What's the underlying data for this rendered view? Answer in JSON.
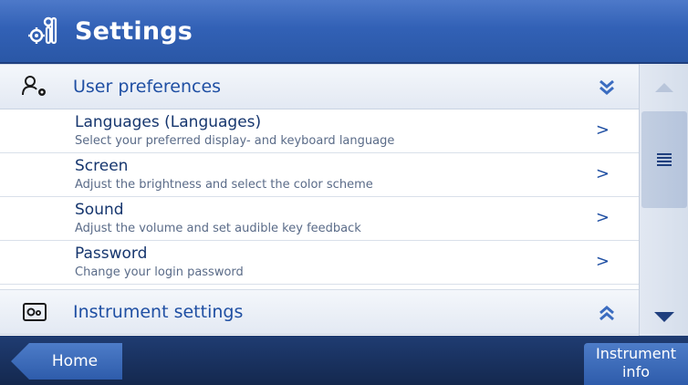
{
  "header": {
    "title": "Settings",
    "icon": "settings-tools-icon"
  },
  "sections": [
    {
      "label": "User preferences",
      "icon": "user-settings-icon",
      "chevron": "double-chevron-down-icon"
    },
    {
      "label": "Instrument settings",
      "icon": "instrument-settings-icon",
      "chevron": "double-chevron-up-icon"
    }
  ],
  "items": [
    {
      "title": "Languages (Languages)",
      "desc": "Select your preferred display- and keyboard language",
      "arrow": ">"
    },
    {
      "title": "Screen",
      "desc": "Adjust the brightness and select the color scheme",
      "arrow": ">"
    },
    {
      "title": "Sound",
      "desc": "Adjust the volume and set audible key feedback",
      "arrow": ">"
    },
    {
      "title": "Password",
      "desc": "Change your login password",
      "arrow": ">"
    }
  ],
  "scrollbar": {
    "up": "scroll-up-icon",
    "thumb": "list-lines-icon",
    "down": "scroll-down-icon"
  },
  "footer": {
    "home_label": "Home",
    "info_label_line1": "Instrument",
    "info_label_line2": "info"
  },
  "colors": {
    "header": "#3261b6",
    "accent": "#1f4fa3",
    "footer": "#1a3260"
  }
}
